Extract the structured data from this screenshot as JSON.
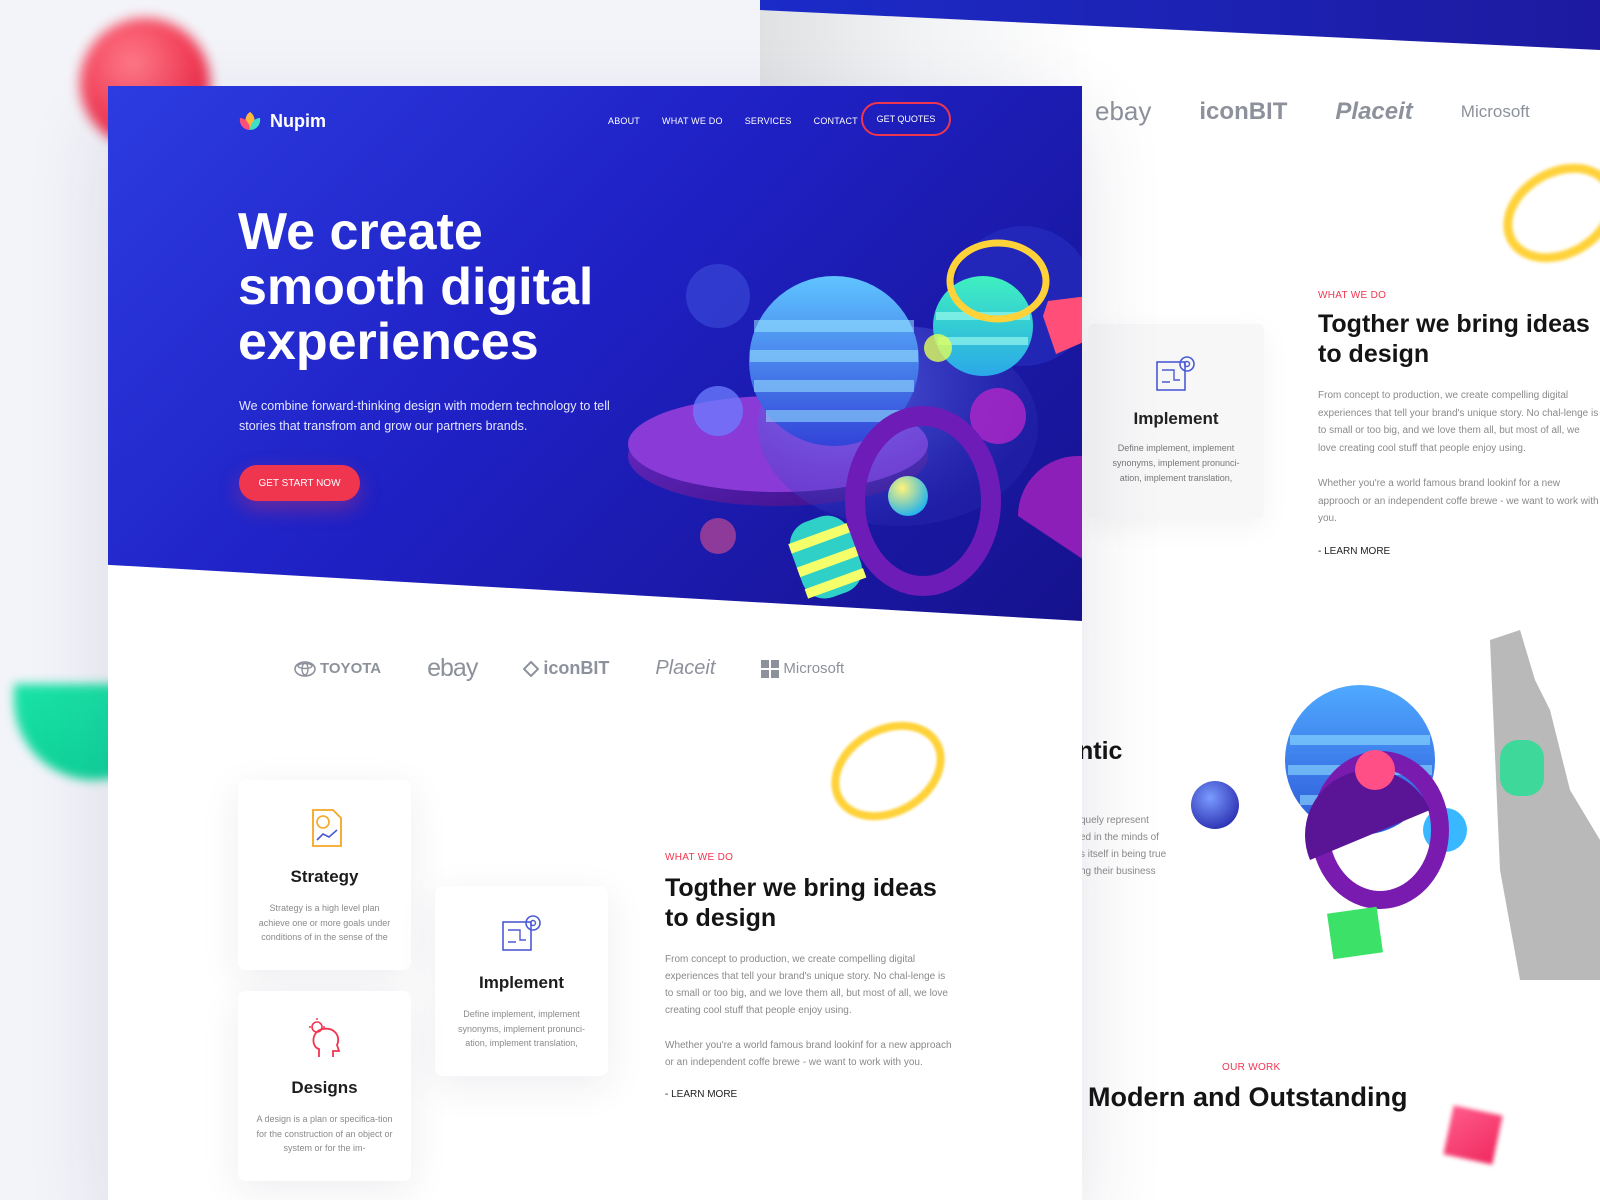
{
  "brand": {
    "name": "Nupim",
    "accent": "#f0354f",
    "primary": "#2431d6"
  },
  "nav": {
    "items": [
      "ABOUT",
      "WHAT WE DO",
      "SERVICES",
      "CONTACT"
    ],
    "cta": "GET QUOTES"
  },
  "hero": {
    "title": "We create smooth digital experiences",
    "subtitle": "We combine forward-thinking design with modern technology to tell stories that transfrom and grow our partners brands.",
    "cta": "GET START NOW"
  },
  "clients": [
    "TOYOTA",
    "ebay",
    "iconBIT",
    "Placeit",
    "Microsoft"
  ],
  "services": [
    {
      "title": "Strategy",
      "text": "Strategy is a high level plan achieve one or more goals under conditions of in the sense of the",
      "icon": "strategy-chart-icon"
    },
    {
      "title": "Implement",
      "text": "Define implement, implement synonyms, implement pronunci-ation, implement translation,",
      "icon": "blueprint-gear-icon"
    },
    {
      "title": "Designs",
      "text": "A design is a plan or specifica-tion for the construction of an object or system or for the im-",
      "icon": "head-lightbulb-icon"
    }
  ],
  "what_we_do": {
    "eyebrow": "WHAT WE DO",
    "title": "Togther we bring ideas to design",
    "p1": "From concept to production, we create compelling digital experiences that tell your brand's unique story. No chal-lenge is to small or too big, and we love them all, but most of all, we love creating cool stuff that people enjoy using.",
    "p2": "Whether you're a world famous brand lookinf for a new approach or an independent coffe brewe - we want to work with you.",
    "link": "- LEARN MORE"
  },
  "bg_page": {
    "clients": [
      "ebay",
      "iconBIT",
      "Placeit",
      "Microsoft"
    ],
    "card_title": "Implement",
    "card_text": "Define implement, implement synonyms, implement pronunci-ation, implement translation,",
    "eyebrow": "WHAT WE DO",
    "title": "Togther we bring ideas to design",
    "p1": "From concept to production, we create compelling digital experiences that tell your brand's unique story. No chal-lenge is to small or too big, and we love them all, but most of all, we love creating cool stuff that people enjoy using.",
    "p2": "Whether you're a world famous brand lookinf for a new approoch or an independent coffe brewe - we want to work with you.",
    "link": "- LEARN MORE",
    "fragment_title": "ntic",
    "fragment_lines": [
      "quely represent",
      "ed in the minds of",
      "s itself in being true",
      "ng their business"
    ],
    "our_work": "OUR WORK",
    "our_work_title": "Modern and  Outstanding"
  }
}
